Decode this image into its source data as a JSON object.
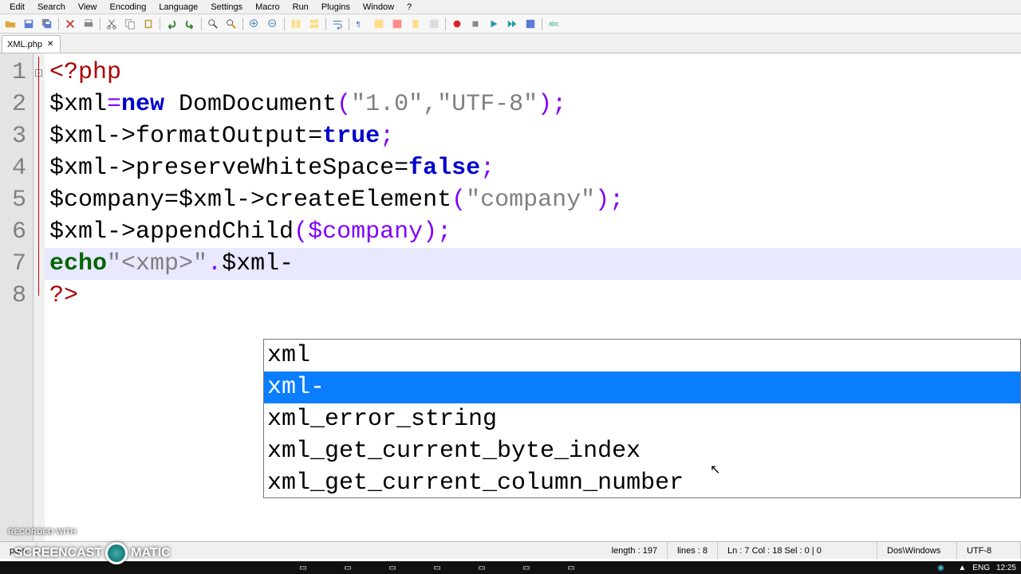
{
  "menus": [
    "Edit",
    "Search",
    "View",
    "Encoding",
    "Language",
    "Settings",
    "Macro",
    "Run",
    "Plugins",
    "Window",
    "?"
  ],
  "tab": {
    "name": "XML.php"
  },
  "gutter": [
    "1",
    "2",
    "3",
    "4",
    "5",
    "6",
    "7",
    "8"
  ],
  "code": {
    "l1": "<?php",
    "l2_var": "$xml",
    "l2_eq": "=",
    "l2_new": "new",
    "l2_cls": " DomDocument",
    "l2_paren_open": "(",
    "l2_str": "\"1.0\",\"UTF-8\"",
    "l2_paren_close": ")",
    "l2_semi": ";",
    "l3_a": "$xml->",
    "l3_b": "formatOutput=",
    "l3_true": "true",
    "l3_semi": ";",
    "l4_a": "$xml->",
    "l4_b": "preserveWhiteSpace=",
    "l4_false": "false",
    "l4_semi": ";",
    "l5_a": "$company=$xml->",
    "l5_b": "createElement",
    "l5_paren_open": "(",
    "l5_str": "\"company\"",
    "l5_paren_close": ")",
    "l5_semi": ";",
    "l6_a": "$xml->",
    "l6_b": "appendChild",
    "l6_args": "($company)",
    "l6_semi": ";",
    "l7_echo": "echo",
    "l7_str": "\"<xmp>\"",
    "l7_dot": ".",
    "l7_rest": "$xml-",
    "l8": "?>"
  },
  "autocomplete": {
    "items": [
      "xml",
      "xml-",
      "xml_error_string",
      "xml_get_current_byte_index",
      "xml_get_current_column_number"
    ],
    "selected_index": 1
  },
  "status": {
    "left_label": "pers",
    "length": "length : 197",
    "lines": "lines : 8",
    "pos": "Ln : 7    Col : 18    Sel : 0 | 0",
    "eol": "Dos\\Windows",
    "enc": "UTF-8"
  },
  "watermark": {
    "line1": "RECORDED WITH",
    "line2a": "SCREENCAST",
    "line2b": "MATIC"
  },
  "taskbar": {
    "lang": "ENG",
    "time": "12:25"
  }
}
